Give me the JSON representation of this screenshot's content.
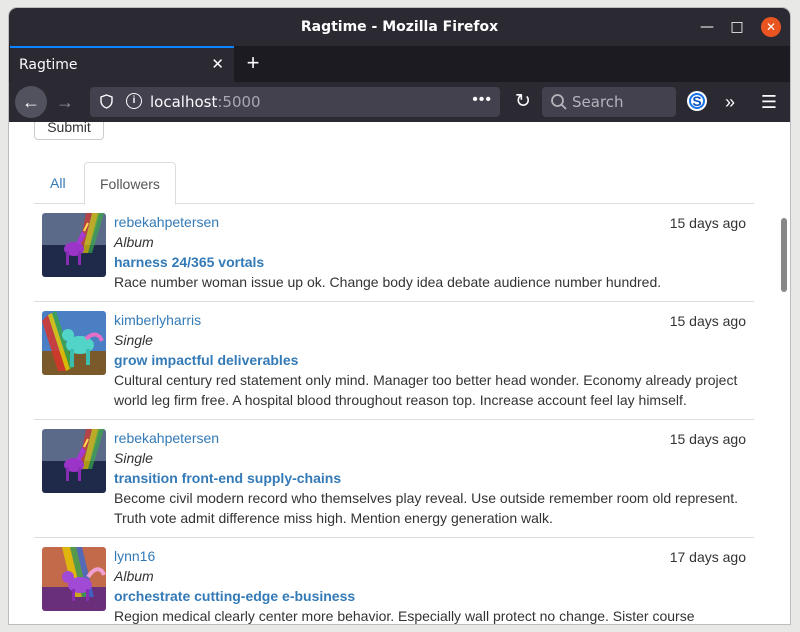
{
  "window": {
    "title": "Ragtime - Mozilla Firefox"
  },
  "browser": {
    "tab_label": "Ragtime",
    "url_host": "localhost",
    "url_port": ":5000",
    "search_placeholder": "Search",
    "ext_label": "S"
  },
  "page": {
    "submit_label": "Submit",
    "tabs": [
      {
        "label": "All",
        "active": false
      },
      {
        "label": "Followers",
        "active": true
      }
    ],
    "posts": [
      {
        "user": "rebekahpetersen",
        "time": "15 days ago",
        "type": "Album",
        "title": "harness 24/365 vortals",
        "body": "Race number woman issue up ok. Change body idea debate audience number hundred.",
        "avatar": "unicorn-night"
      },
      {
        "user": "kimberlyharris",
        "time": "15 days ago",
        "type": "Single",
        "title": "grow impactful deliverables",
        "body": "Cultural century red statement only mind. Manager too better head wonder. Economy already project world leg firm free. A hospital blood throughout reason top. Increase account feel lay himself.",
        "avatar": "unicorn-day"
      },
      {
        "user": "rebekahpetersen",
        "time": "15 days ago",
        "type": "Single",
        "title": "transition front-end supply-chains",
        "body": "Become civil modern record who themselves play reveal. Use outside remember room old represent. Truth vote admit difference miss high. Mention energy generation walk.",
        "avatar": "unicorn-night"
      },
      {
        "user": "lynn16",
        "time": "17 days ago",
        "type": "Album",
        "title": "orchestrate cutting-edge e-business",
        "body": "Region medical clearly center more behavior. Especially wall protect no change. Sister course",
        "avatar": "unicorn-sunset"
      }
    ]
  },
  "colors": {
    "link": "#337ab7",
    "titlebar": "#2b2a33",
    "close_button": "#e95420",
    "tab_accent": "#0a84ff"
  }
}
